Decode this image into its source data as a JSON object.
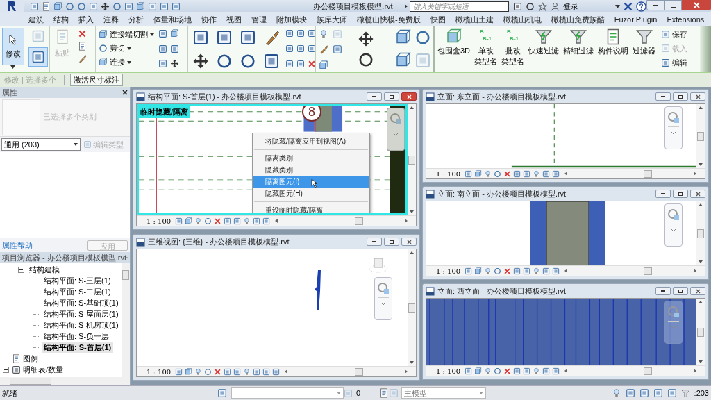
{
  "title_bar": {
    "title": "办公楼项目模板模型.rvt",
    "search": {
      "placeholder": "键入关键字或短语"
    },
    "sign_in": "登录"
  },
  "tabs": [
    {
      "label": "建筑"
    },
    {
      "label": "结构"
    },
    {
      "label": "插入"
    },
    {
      "label": "注释"
    },
    {
      "label": "分析"
    },
    {
      "label": "体量和场地"
    },
    {
      "label": "协作"
    },
    {
      "label": "视图"
    },
    {
      "label": "管理"
    },
    {
      "label": "附加模块"
    },
    {
      "label": "族库大师"
    },
    {
      "label": "橄榄山快模-免费版"
    },
    {
      "label": "快图"
    },
    {
      "label": "橄榄山土建"
    },
    {
      "label": "橄榄山机电"
    },
    {
      "label": "橄榄山免费族酷"
    },
    {
      "label": "Fuzor Plugin"
    },
    {
      "label": "Extensions"
    }
  ],
  "ribbon": {
    "modify": {
      "label": "修改",
      "selected": true
    },
    "paste": {
      "label": "粘贴",
      "disabled": true
    },
    "geometry": [
      {
        "label": "连接端切割"
      },
      {
        "label": "剪切"
      },
      {
        "label": "连接"
      }
    ],
    "tools": [
      {
        "lines": [
          "包围盒3D"
        ],
        "kind": "box3d"
      },
      {
        "lines": [
          "单改",
          "类型名"
        ],
        "kind": "rename",
        "icon_text": [
          "B",
          "B-1"
        ]
      },
      {
        "lines": [
          "批改",
          "类型名"
        ],
        "kind": "rename",
        "icon_text": [
          "B",
          "B-1"
        ]
      },
      {
        "lines": [
          "快速过滤"
        ],
        "kind": "funnel"
      },
      {
        "lines": [
          "精细过滤"
        ],
        "kind": "funnel"
      },
      {
        "lines": [
          "构件说明"
        ],
        "kind": "note"
      },
      {
        "lines": [
          "过滤器"
        ],
        "kind": "plainfunnel"
      }
    ],
    "selection": [
      {
        "label": "保存",
        "disabled": false
      },
      {
        "label": "载入",
        "disabled": true
      },
      {
        "label": "编辑",
        "disabled": false
      }
    ]
  },
  "options_bar": {
    "context": "修改 | 选择多个",
    "button": "激活尺寸标注"
  },
  "properties": {
    "title": "属性",
    "type_name": "已选择多个类别",
    "filter": "通用 (203)",
    "edit_type": "编辑类型",
    "help_link": "属性帮助",
    "apply": "应用"
  },
  "project_browser": {
    "title": "项目浏览器 - 办公楼项目模板模型.rvt",
    "tree": [
      {
        "label": "结构建模",
        "expanded": true,
        "children": [
          {
            "label": "结构平面: S-三层(1)",
            "selected": false
          },
          {
            "label": "结构平面: S-二层(1)",
            "selected": false
          },
          {
            "label": "结构平面: S-基础顶(1)",
            "selected": false
          },
          {
            "label": "结构平面: S-屋面层(1)",
            "selected": false
          },
          {
            "label": "结构平面: S-机房顶(1)",
            "selected": false
          },
          {
            "label": "结构平面: S-负一层",
            "selected": false
          },
          {
            "label": "结构平面: S-首层(1)",
            "selected": true
          }
        ]
      },
      {
        "label": "图例",
        "kind": "legend"
      },
      {
        "label": "明细表/数量",
        "kind": "schedule",
        "expanded": true
      }
    ]
  },
  "views": [
    {
      "title": "结构平面: S-首层(1) - 办公楼项目模板模型.rvt",
      "scale": "1 : 100",
      "kind": "plan",
      "active": true,
      "overlay_label": "临时隐藏/隔离",
      "grid_bubble": "8"
    },
    {
      "title": "三维视图: {三维} - 办公楼项目模板模型.rvt",
      "scale": "1 : 100",
      "kind": "perspective",
      "active": false
    },
    {
      "title": "立面: 东立面 - 办公楼项目模板模型.rvt",
      "scale": "1 : 100",
      "kind": "east",
      "active": false
    },
    {
      "title": "立面: 南立面 - 办公楼项目模板模型.rvt",
      "scale": "1 : 100",
      "kind": "south",
      "active": false
    },
    {
      "title": "立面: 西立面 - 办公楼项目模板模型.rvt",
      "scale": "1 : 100",
      "kind": "west",
      "active": false
    }
  ],
  "context_menu": {
    "groups": [
      [
        {
          "label": "将隐藏/隔离应用到视图(A)",
          "selected": false
        }
      ],
      [
        {
          "label": "隔离类别",
          "selected": false
        },
        {
          "label": "隐藏类别",
          "selected": false
        },
        {
          "label": "隔离图元(I)",
          "selected": true
        },
        {
          "label": "隐藏图元(H)",
          "selected": false
        }
      ],
      [
        {
          "label": "重设临时隐藏/隔离",
          "selected": false
        }
      ]
    ]
  },
  "status_bar": {
    "message": "就绪",
    "filter_count": ":0",
    "model": "主模型",
    "selected_count": ":203"
  }
}
